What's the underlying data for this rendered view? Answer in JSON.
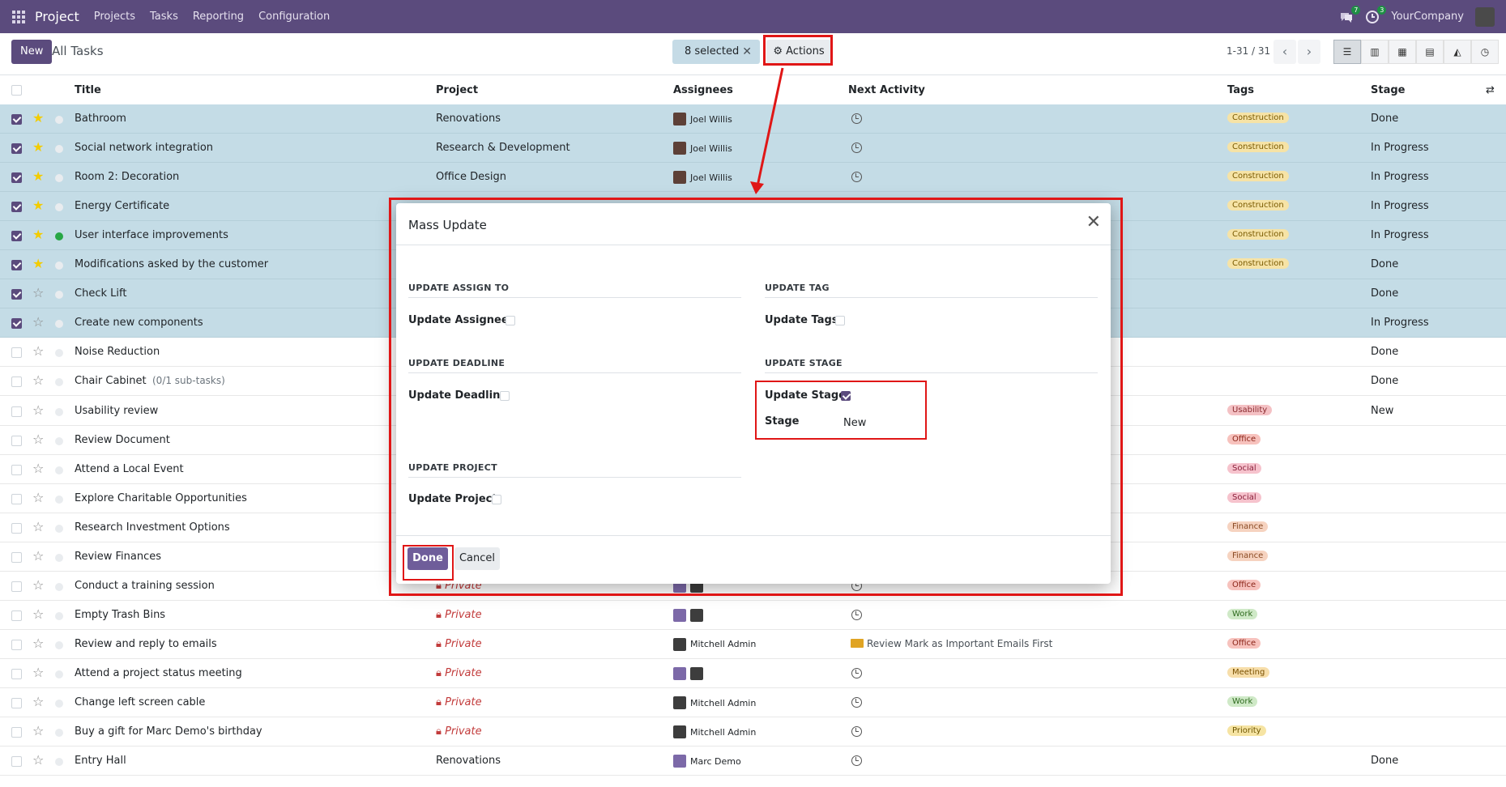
{
  "navbar": {
    "brand": "Project",
    "menu": [
      "Projects",
      "Tasks",
      "Reporting",
      "Configuration"
    ],
    "chat_count": "7",
    "activity_count": "3",
    "company": "YourCompany"
  },
  "control": {
    "new_label": "New",
    "breadcrumb": "All Tasks",
    "selected_label": "8 selected",
    "actions_label": "⚙ Actions",
    "pager": "1-31 / 31"
  },
  "list": {
    "headers": {
      "title": "Title",
      "project": "Project",
      "assignees": "Assignees",
      "next_activity": "Next Activity",
      "tags": "Tags",
      "stage": "Stage"
    },
    "rows": [
      {
        "title": "Bathroom",
        "project": "Renovations",
        "assignee": "Joel Willis",
        "tag": "Construction",
        "stage": "Done",
        "selected": true,
        "starred": true
      },
      {
        "title": "Social network integration",
        "project": "Research & Development",
        "assignee": "Joel Willis",
        "tag": "Construction",
        "stage": "In Progress",
        "selected": true,
        "starred": true
      },
      {
        "title": "Room 2: Decoration",
        "project": "Office Design",
        "assignee": "Joel Willis",
        "tag": "Construction",
        "stage": "In Progress",
        "selected": true,
        "starred": true
      },
      {
        "title": "Energy Certificate",
        "project": "",
        "assignee": "",
        "tag": "Construction",
        "stage": "In Progress",
        "selected": true,
        "starred": true
      },
      {
        "title": "User interface improvements",
        "project": "",
        "assignee": "",
        "tag": "Construction",
        "stage": "In Progress",
        "selected": true,
        "starred": true
      },
      {
        "title": "Modifications asked by the customer",
        "project": "",
        "assignee": "",
        "tag": "Construction",
        "stage": "Done",
        "selected": true,
        "starred": true
      },
      {
        "title": "Check Lift",
        "project": "",
        "assignee": "",
        "tag": "",
        "stage": "Done",
        "selected": true,
        "starred": false
      },
      {
        "title": "Create new components",
        "project": "",
        "assignee": "",
        "tag": "",
        "stage": "In Progress",
        "selected": true,
        "starred": false
      },
      {
        "title": "Noise Reduction",
        "project": "",
        "assignee": "",
        "tag": "",
        "stage": "Done",
        "selected": false,
        "starred": false
      },
      {
        "title": "Chair Cabinet",
        "subtasks": "(0/1 sub-tasks)",
        "project": "",
        "assignee": "",
        "tag": "",
        "stage": "Done",
        "selected": false,
        "starred": false
      },
      {
        "title": "Usability review",
        "project": "",
        "assignee": "",
        "tag": "Usability",
        "stage": "New",
        "selected": false,
        "starred": false
      },
      {
        "title": "Review Document",
        "project": "",
        "assignee": "",
        "tag": "Office",
        "stage": "",
        "selected": false,
        "starred": false
      },
      {
        "title": "Attend a Local Event",
        "project": "",
        "assignee": "",
        "tag": "Social",
        "stage": "",
        "selected": false,
        "starred": false
      },
      {
        "title": "Explore Charitable Opportunities",
        "project": "",
        "assignee": "",
        "tag": "Social",
        "stage": "",
        "selected": false,
        "starred": false
      },
      {
        "title": "Research Investment Options",
        "project": "",
        "assignee": "",
        "tag": "Finance",
        "stage": "",
        "selected": false,
        "starred": false
      },
      {
        "title": "Review Finances",
        "project": "",
        "assignee": "",
        "tag": "Finance",
        "stage": "",
        "selected": false,
        "starred": false
      },
      {
        "title": "Conduct a training session",
        "project": "Private",
        "assignee": "",
        "tag": "Office",
        "stage": "",
        "selected": false,
        "starred": false
      },
      {
        "title": "Empty Trash Bins",
        "project": "Private",
        "assignee": "",
        "tag": "Work",
        "stage": "",
        "selected": false,
        "starred": false
      },
      {
        "title": "Review and reply to emails",
        "project": "Private",
        "assignee": "Mitchell Admin",
        "activity": "Review Mark as Important Emails First",
        "tag": "Office",
        "stage": "",
        "selected": false,
        "starred": false
      },
      {
        "title": "Attend a project status meeting",
        "project": "Private",
        "assignee": "",
        "tag": "Meeting",
        "stage": "",
        "selected": false,
        "starred": false
      },
      {
        "title": "Change left screen cable",
        "project": "Private",
        "assignee": "Mitchell Admin",
        "tag": "Work",
        "stage": "",
        "selected": false,
        "starred": false
      },
      {
        "title": "Buy a gift for Marc Demo's birthday",
        "project": "Private",
        "assignee": "Mitchell Admin",
        "tag": "Priority",
        "stage": "",
        "selected": false,
        "starred": false
      },
      {
        "title": "Entry Hall",
        "project": "Renovations",
        "assignee": "Marc Demo",
        "tag": "",
        "stage": "Done",
        "selected": false,
        "starred": false
      }
    ]
  },
  "modal": {
    "title": "Mass Update",
    "sections": {
      "assign": "UPDATE ASSIGN TO",
      "tag": "UPDATE TAG",
      "deadline": "UPDATE DEADLINE",
      "stage": "UPDATE STAGE",
      "project": "UPDATE PROJECT"
    },
    "fields": {
      "assignees": "Update Assignees",
      "tags": "Update Tags",
      "deadline": "Update Deadline",
      "update_stage": "Update Stage",
      "stage": "Stage",
      "stage_value": "New",
      "project": "Update Project"
    },
    "done_label": "Done",
    "cancel_label": "Cancel"
  },
  "colors": {
    "brand": "#5b4b7d",
    "selected_row": "#c4dce6",
    "annotation": "#e01616"
  }
}
